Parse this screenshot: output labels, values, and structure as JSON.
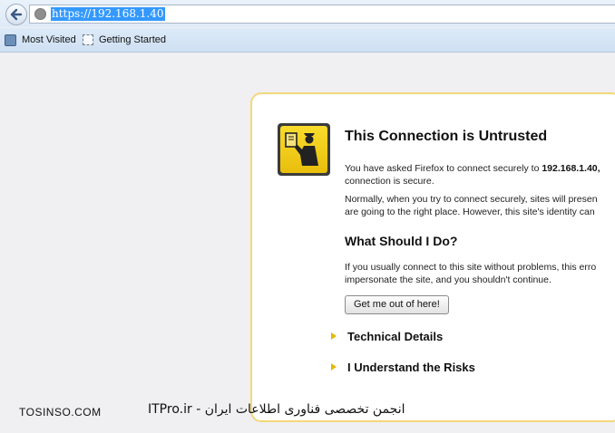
{
  "browser": {
    "url": "https://192.168.1.40",
    "bookmarks": [
      {
        "label": "Most Visited",
        "icon": "bookmarks-folder-icon"
      },
      {
        "label": "Getting Started",
        "icon": "page-icon"
      }
    ]
  },
  "error_page": {
    "title": "This Connection is Untrusted",
    "intro_prefix": "You have asked Firefox to connect securely to ",
    "intro_host": "192.168.1.40,",
    "intro_line2": "connection is secure.",
    "normally_line1": "Normally, when you try to connect securely, sites will presen",
    "normally_line2": "are going to the right place. However, this site's identity can",
    "what_heading": "What Should I Do?",
    "what_line1": "If you usually connect to this site without problems, this erro",
    "what_line2": "impersonate the site, and you shouldn't continue.",
    "button_label": "Get me out of here!",
    "expanders": [
      {
        "label": "Technical Details"
      },
      {
        "label": "I Understand the Risks"
      }
    ]
  },
  "watermark": {
    "left": "TOSINSO.COM",
    "right": "ITPro.ir - انجمن تخصصی فناوری اطلاعات ایران"
  }
}
